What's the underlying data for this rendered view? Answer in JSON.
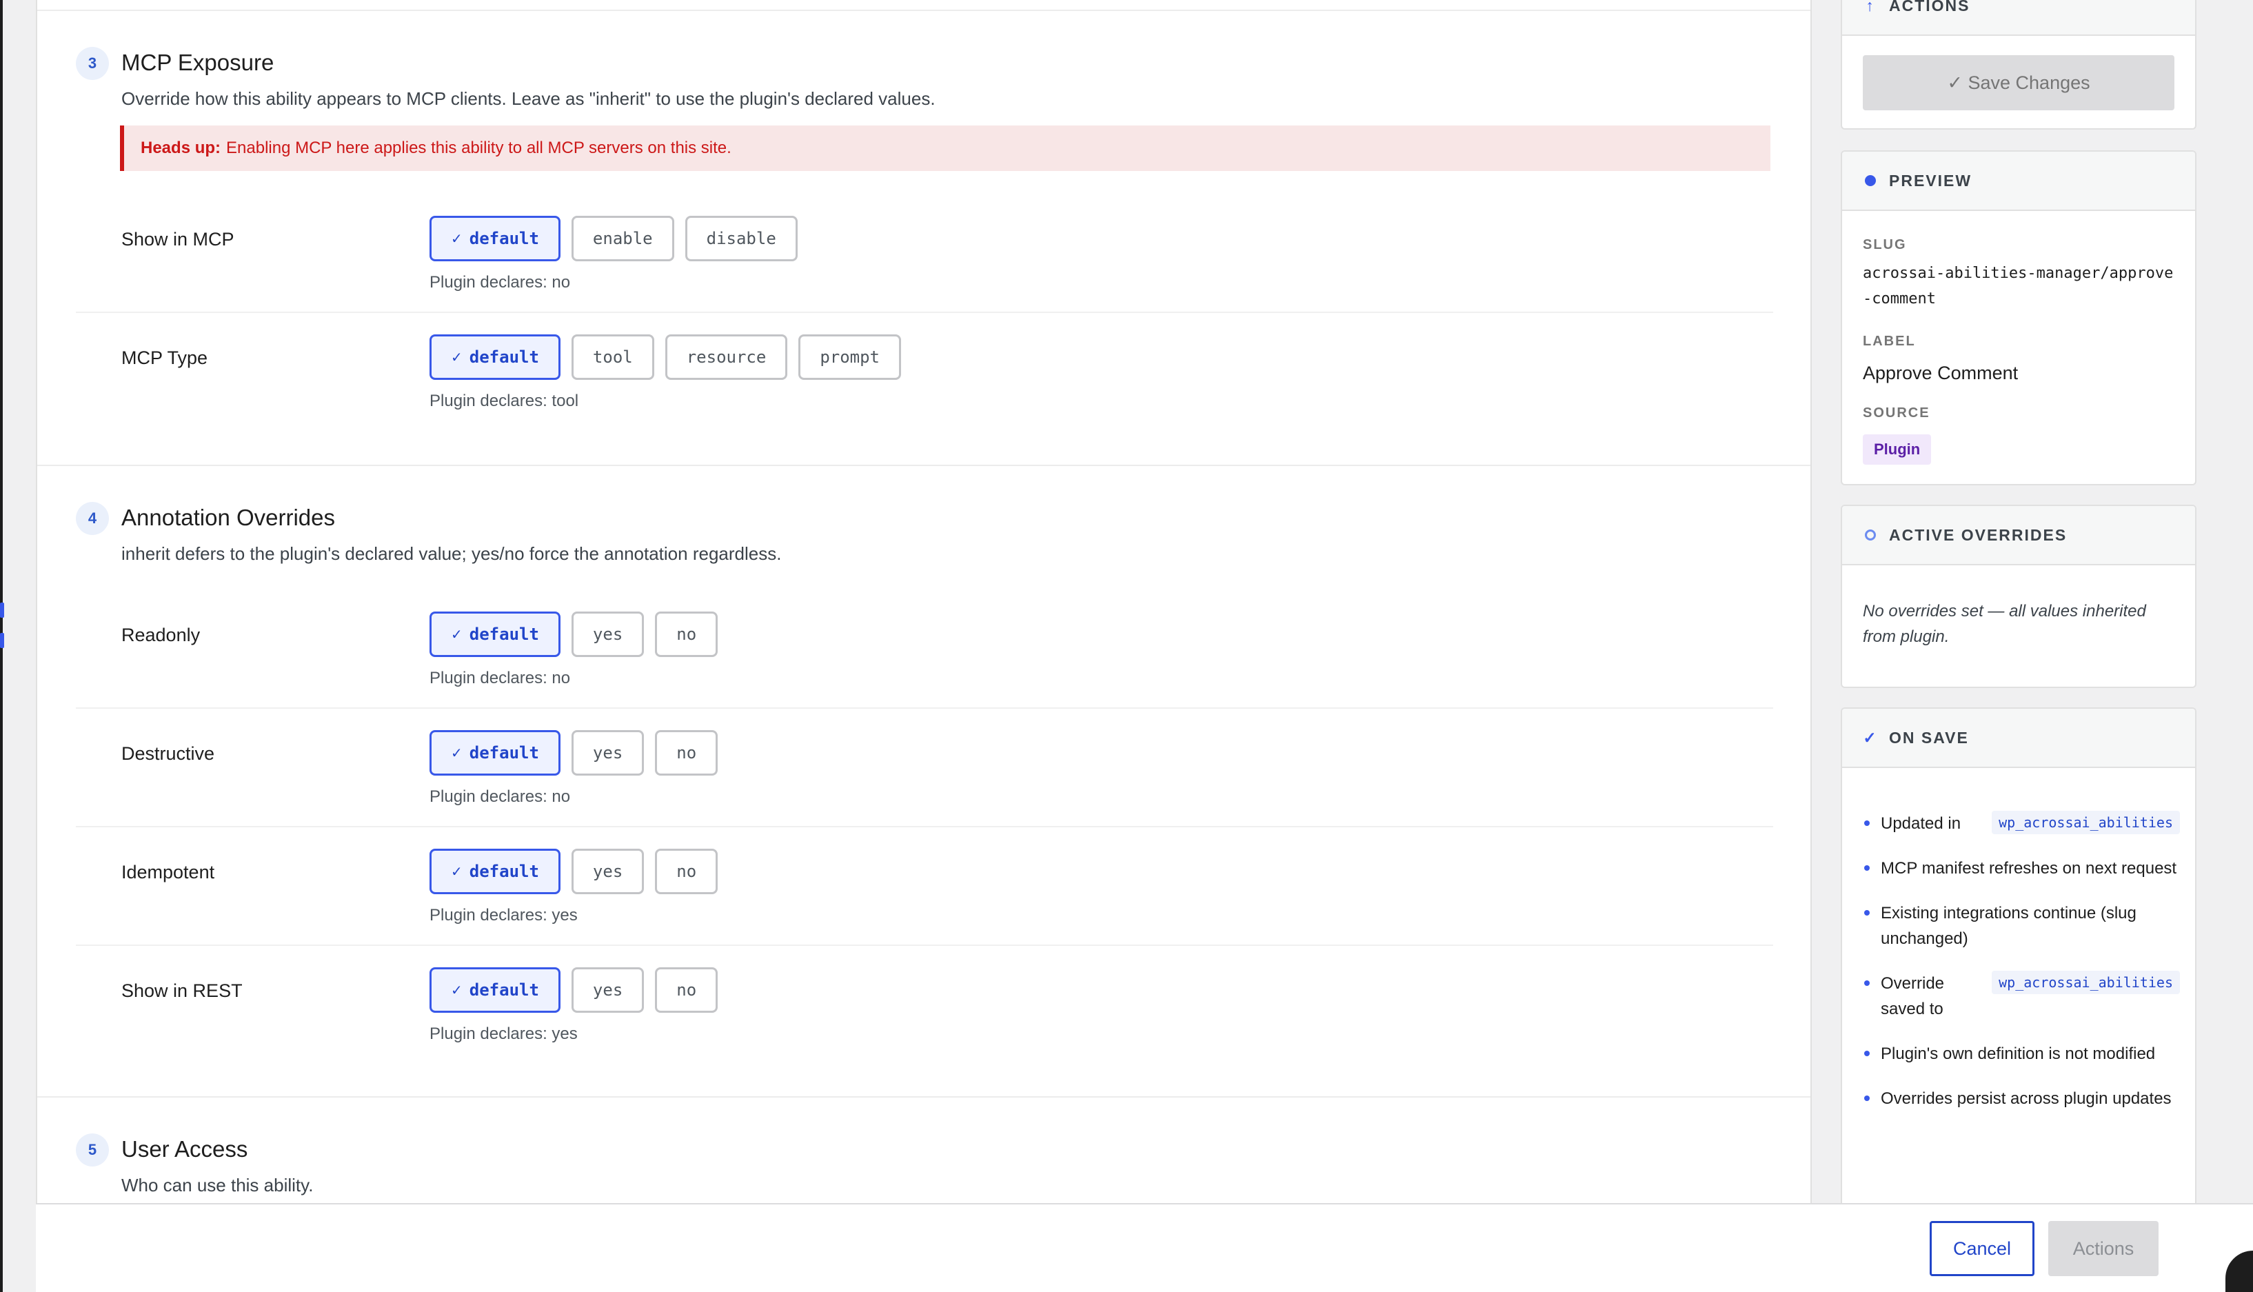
{
  "sections": {
    "mcp": {
      "number": "3",
      "title": "MCP Exposure",
      "description": "Override how this ability appears to MCP clients. Leave as \"inherit\" to use the plugin's declared values.",
      "alert_strong": "Heads up:",
      "alert_text": "Enabling MCP here applies this ability to all MCP servers on this site.",
      "show_in_mcp": {
        "label": "Show in MCP",
        "options": [
          "default",
          "enable",
          "disable"
        ],
        "selected": "default",
        "hint": "Plugin declares: no"
      },
      "mcp_type": {
        "label": "MCP Type",
        "options": [
          "default",
          "tool",
          "resource",
          "prompt"
        ],
        "selected": "default",
        "hint": "Plugin declares: tool"
      }
    },
    "annotations": {
      "number": "4",
      "title": "Annotation Overrides",
      "description": "inherit defers to the plugin's declared value; yes/no force the annotation regardless.",
      "readonly": {
        "label": "Readonly",
        "options": [
          "default",
          "yes",
          "no"
        ],
        "selected": "default",
        "hint": "Plugin declares: no"
      },
      "destructive": {
        "label": "Destructive",
        "options": [
          "default",
          "yes",
          "no"
        ],
        "selected": "default",
        "hint": "Plugin declares: no"
      },
      "idempotent": {
        "label": "Idempotent",
        "options": [
          "default",
          "yes",
          "no"
        ],
        "selected": "default",
        "hint": "Plugin declares: yes"
      },
      "show_in_rest": {
        "label": "Show in REST",
        "options": [
          "default",
          "yes",
          "no"
        ],
        "selected": "default",
        "hint": "Plugin declares: yes"
      }
    },
    "user_access": {
      "number": "5",
      "title": "User Access",
      "description": "Who can use this ability."
    }
  },
  "sidebar": {
    "actions": {
      "title": "ACTIONS",
      "icon": "arrow-up-icon",
      "save_label": "✓ Save Changes"
    },
    "preview": {
      "title": "PREVIEW",
      "slug_label": "SLUG",
      "slug": "acrossai-abilities-manager/approve-comment",
      "label_label": "LABEL",
      "label": "Approve Comment",
      "source_label": "SOURCE",
      "source": "Plugin"
    },
    "active_overrides": {
      "title": "ACTIVE OVERRIDES",
      "empty": "No overrides set — all values inherited from plugin."
    },
    "on_save": {
      "title": "ON SAVE",
      "items": [
        {
          "text": "Updated in",
          "code": "wp_acrossai_abilities"
        },
        {
          "text": "MCP manifest refreshes on next request",
          "code": ""
        },
        {
          "text": "Existing integrations continue (slug unchanged)",
          "code": ""
        },
        {
          "text": "Override saved to",
          "code": "wp_acrossai_abilities"
        },
        {
          "text": "Plugin's own definition is not modified",
          "code": ""
        },
        {
          "text": "Overrides persist across plugin updates",
          "code": ""
        }
      ]
    }
  },
  "footer": {
    "cancel": "Cancel",
    "actions": "Actions"
  },
  "colors": {
    "accent": "#3858e9",
    "alert": "#cc1818",
    "source_badge": "#5b1fa6"
  }
}
